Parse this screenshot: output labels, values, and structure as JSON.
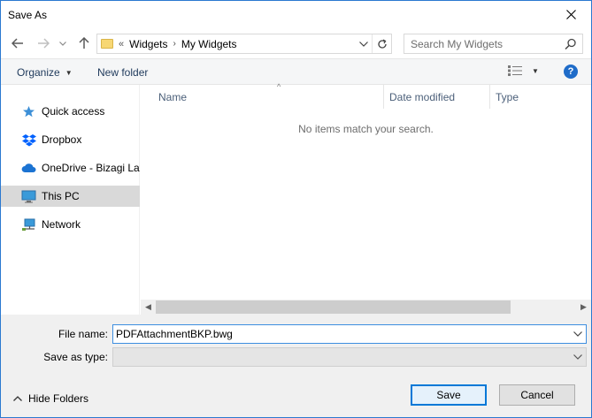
{
  "window": {
    "title": "Save As"
  },
  "address": {
    "overflow": "«",
    "segments": [
      "Widgets",
      "My Widgets"
    ]
  },
  "search": {
    "placeholder": "Search My Widgets"
  },
  "toolbar": {
    "organize_label": "Organize",
    "new_folder_label": "New folder"
  },
  "sidebar": {
    "items": [
      {
        "label": "Quick access",
        "icon": "star-icon"
      },
      {
        "label": "Dropbox",
        "icon": "dropbox-icon"
      },
      {
        "label": "OneDrive - Bizagi Lat",
        "icon": "cloud-icon"
      },
      {
        "label": "This PC",
        "icon": "computer-icon",
        "selected": true
      },
      {
        "label": "Network",
        "icon": "network-icon"
      }
    ]
  },
  "filelist": {
    "columns": [
      "Name",
      "Date modified",
      "Type"
    ],
    "empty_message": "No items match your search."
  },
  "form": {
    "filename_label": "File name:",
    "filename_value": "PDFAttachmentBKP.bwg",
    "savetype_label": "Save as type:",
    "savetype_value": ""
  },
  "footer": {
    "hide_folders_label": "Hide Folders",
    "save_label": "Save",
    "cancel_label": "Cancel"
  },
  "colors": {
    "accent": "#0078d7",
    "selection": "#d9d9d9",
    "help": "#1f6cc9"
  }
}
